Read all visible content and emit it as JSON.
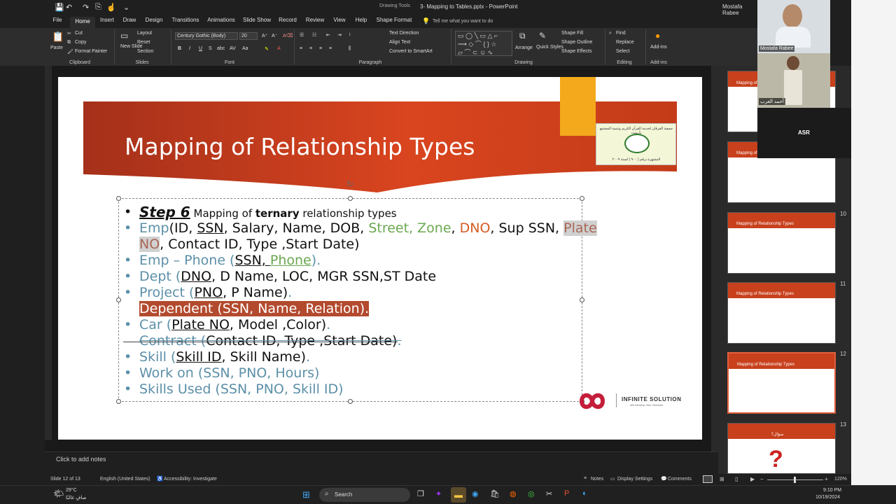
{
  "window": {
    "contextual_tab_group": "Drawing Tools",
    "title": "3- Mapping to Tables.pptx  -  PowerPoint",
    "user": "Mostafa Rabee"
  },
  "ribbon": {
    "tabs": [
      "File",
      "Home",
      "Insert",
      "Draw",
      "Design",
      "Transitions",
      "Animations",
      "Slide Show",
      "Record",
      "Review",
      "View",
      "Help",
      "Shape Format"
    ],
    "active_tab": "Home",
    "tell_me_placeholder": "Tell me what you want to do",
    "clipboard": {
      "paste": "Paste",
      "cut": "Cut",
      "copy": "Copy",
      "format_painter": "Format Painter",
      "label": "Clipboard"
    },
    "slides": {
      "new_slide": "New Slide",
      "layout": "Layout",
      "reset": "Reset",
      "section": "Section",
      "label": "Slides"
    },
    "font": {
      "name": "Century Gothic (Body)",
      "size": "20",
      "label": "Font"
    },
    "paragraph": {
      "text_direction": "Text Direction",
      "align_text": "Align Text",
      "smartart": "Convert to SmartArt",
      "label": "Paragraph"
    },
    "drawing": {
      "arrange": "Arrange",
      "quick_styles": "Quick Styles",
      "shape_fill": "Shape Fill",
      "shape_outline": "Shape Outline",
      "shape_effects": "Shape Effects",
      "label": "Drawing"
    },
    "editing": {
      "find": "Find",
      "replace": "Replace",
      "select": "Select",
      "label": "Editing"
    },
    "addins": {
      "button": "Add-ins",
      "label": "Add-ins"
    }
  },
  "slide": {
    "title": "Mapping of Relationship Types",
    "logo_text": "INFINITE SOLUTION",
    "logo_tagline": "We Develop Your Services",
    "arabic_org": "جمعية الفرقان لخدمة القرآن الكريم وتنمية المجتمع بأرمنت",
    "arabic_reg": "المشهرة برقم ( ٩٠٠ ) لسنة ٢٠٠٩",
    "lines": {
      "l1_step": "Step 6",
      "l1_a": " Mapping of ",
      "l1_b": "ternary",
      "l1_c": " relationship types",
      "l2_a": "Emp",
      "l2_b": "(ID, ",
      "l2_c": "SSN",
      "l2_d": ", Salary, Name, DOB, ",
      "l2_e": "Street, Zone",
      "l2_f": ", ",
      "l2_g": "DNO",
      "l2_h": ", Sup SSN, ",
      "l2_i": "Plate",
      "l3_a": "NO",
      "l3_b": ", Contact ID, Type ,Start Date)",
      "l4_a": "Emp – Phone (",
      "l4_b": "SSN, ",
      "l4_c": "Phone",
      "l4_d": ").",
      "l5_a": "Dept (",
      "l5_b": "DNO",
      "l5_c": ", D Name, LOC, MGR SSN,ST Date",
      "l6_a": "Project (",
      "l6_b": "PNO",
      "l6_c": ", P Name)",
      "l6_d": ".",
      "l7": "Dependent (SSN, Name, Relation).",
      "l8_a": "Car (",
      "l8_b": "Plate NO",
      "l8_c": ", Model ,Color)",
      "l8_d": ".",
      "l9_a": "Contract (",
      "l9_b": "Contact ID",
      "l9_c": ", Type ,Start Date)",
      "l9_d": ".",
      "l10_a": "Skill (",
      "l10_b": "Skill ID",
      "l10_c": ", Skill Name)",
      "l10_d": ".",
      "l11": "Work on (SSN, PNO, Hours)",
      "l12": "Skills Used (SSN, PNO, Skill ID)"
    }
  },
  "notes_placeholder": "Click to add notes",
  "thumbnails": [
    {
      "num": "",
      "title": "Mapping of Relationship Types"
    },
    {
      "num": "",
      "title": "Mapping of Relationship Types"
    },
    {
      "num": "10",
      "title": "Mapping of Relationship Types"
    },
    {
      "num": "11",
      "title": "Mapping of Relationship Types"
    },
    {
      "num": "12",
      "title": "Mapping of Relationship Types"
    },
    {
      "num": "13",
      "title": "سؤال؟"
    }
  ],
  "participants": [
    {
      "name": "Mostafa Rabee"
    },
    {
      "name": "أحمد العرب"
    },
    {
      "name": "ASR"
    }
  ],
  "status": {
    "slide_count": "Slide 12 of 13",
    "language": "English (United States)",
    "accessibility": "Accessibility: Investigate",
    "notes": "Notes",
    "display": "Display Settings",
    "comments": "Comments",
    "zoom": "120%"
  },
  "taskbar": {
    "weather_temp": "29°C",
    "weather_desc": "صافٍ غالبًا",
    "search": "Search",
    "time": "9:10 PM",
    "date": "10/19/2024"
  },
  "colors": {
    "accent": "#c43b1b",
    "orange": "#f3a91b",
    "teal": "#5c8fa8"
  }
}
